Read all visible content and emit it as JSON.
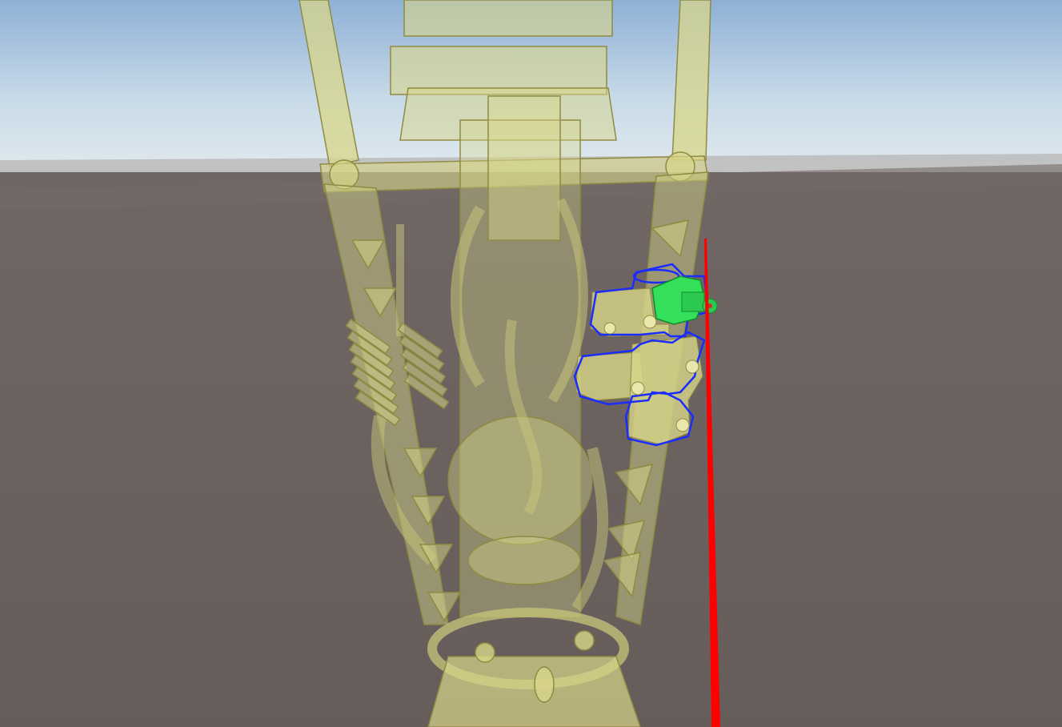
{
  "viewport": {
    "sky_top_color": "#8fb0d6",
    "sky_horizon_color": "#dfe9ef",
    "ground_color": "#6a605e",
    "model_color": "#d8d68a",
    "model_outline_color": "#8f8b42",
    "selection_outline_color": "#1a2cff",
    "selected_part_color": "#34e05a",
    "axis_line_color": "#ff0000",
    "model": {
      "name": "rocket-engine-model",
      "rendering": "semi-transparent"
    },
    "selection": {
      "outlined_parts": 3,
      "highlighted_part_icon": "valve-icon"
    },
    "gizmo": {
      "axis": "red-axis-line",
      "icon": "axis-icon"
    }
  }
}
